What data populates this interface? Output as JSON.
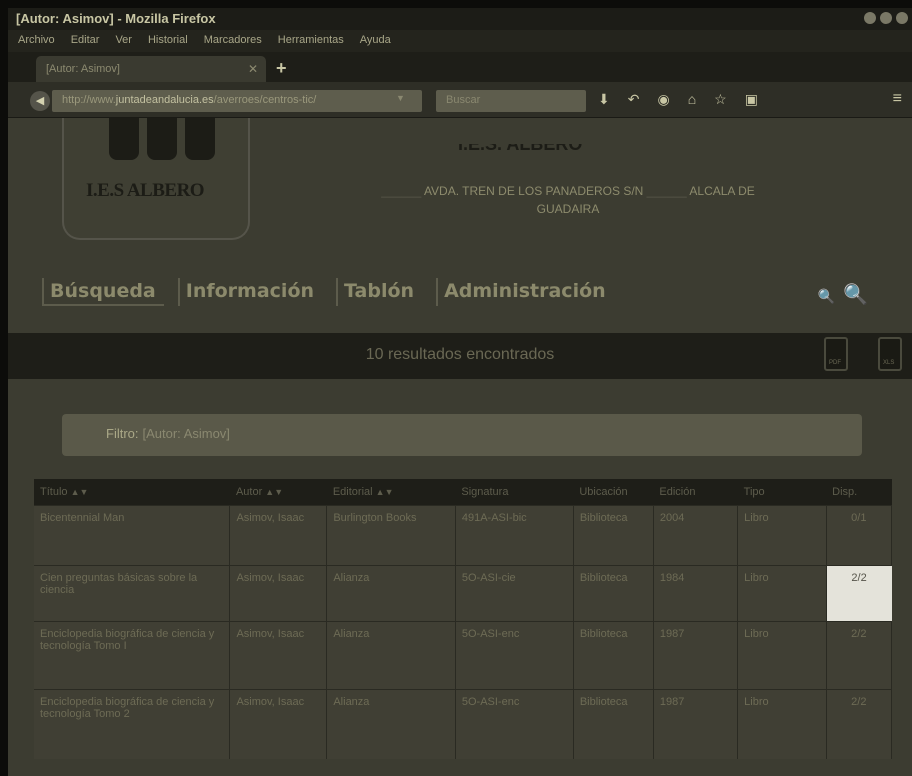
{
  "browser": {
    "window_title": "[Autor: Asimov] - Mozilla Firefox",
    "menu": [
      "Archivo",
      "Editar",
      "Ver",
      "Historial",
      "Marcadores",
      "Herramientas",
      "Ayuda"
    ],
    "tab_title": "[Autor: Asimov]",
    "url_prefix": "http://www.",
    "url_host": "juntadeandalucia.es",
    "url_rest": "/averroes/centros-tic/",
    "search_placeholder": "Buscar"
  },
  "site": {
    "logo_text": "I.E.S ALBERO",
    "school_name": "I.E.S. ALBERO",
    "address_line1": "AVDA. TREN DE LOS PANADEROS S/N",
    "address_city": "ALCALA DE",
    "address_line2": "GUADAIRA"
  },
  "nav": {
    "busqueda": "Búsqueda",
    "informacion": "Información",
    "tablon": "Tablón",
    "administracion": "Administración"
  },
  "results": {
    "summary": "10 resultados encontrados",
    "export_pdf": "PDF",
    "export_xls": "XLS"
  },
  "filter": {
    "label": "Filtro:",
    "value": "[Autor: Asimov]"
  },
  "table": {
    "headers": [
      "Título",
      "Autor",
      "Editorial",
      "Signatura",
      "Ubicación",
      "Edición",
      "Tipo",
      "Disp."
    ],
    "rows": [
      [
        "Bicentennial Man",
        "Asimov, Isaac",
        "Burlington Books",
        "491A-ASI-bic",
        "Biblioteca",
        "2004",
        "Libro",
        "0/1"
      ],
      [
        "Cien preguntas básicas sobre la ciencia",
        "Asimov, Isaac",
        "Alianza",
        "5O-ASI-cie",
        "Biblioteca",
        "1984",
        "Libro",
        "2/2"
      ],
      [
        "Enciclopedia biográfica de ciencia y tecnología Tomo I",
        "Asimov, Isaac",
        "Alianza",
        "5O-ASI-enc",
        "Biblioteca",
        "1987",
        "Libro",
        "2/2"
      ],
      [
        "Enciclopedia biográfica de ciencia y tecnología Tomo 2",
        "Asimov, Isaac",
        "Alianza",
        "5O-ASI-enc",
        "Biblioteca",
        "1987",
        "Libro",
        "2/2"
      ]
    ]
  }
}
